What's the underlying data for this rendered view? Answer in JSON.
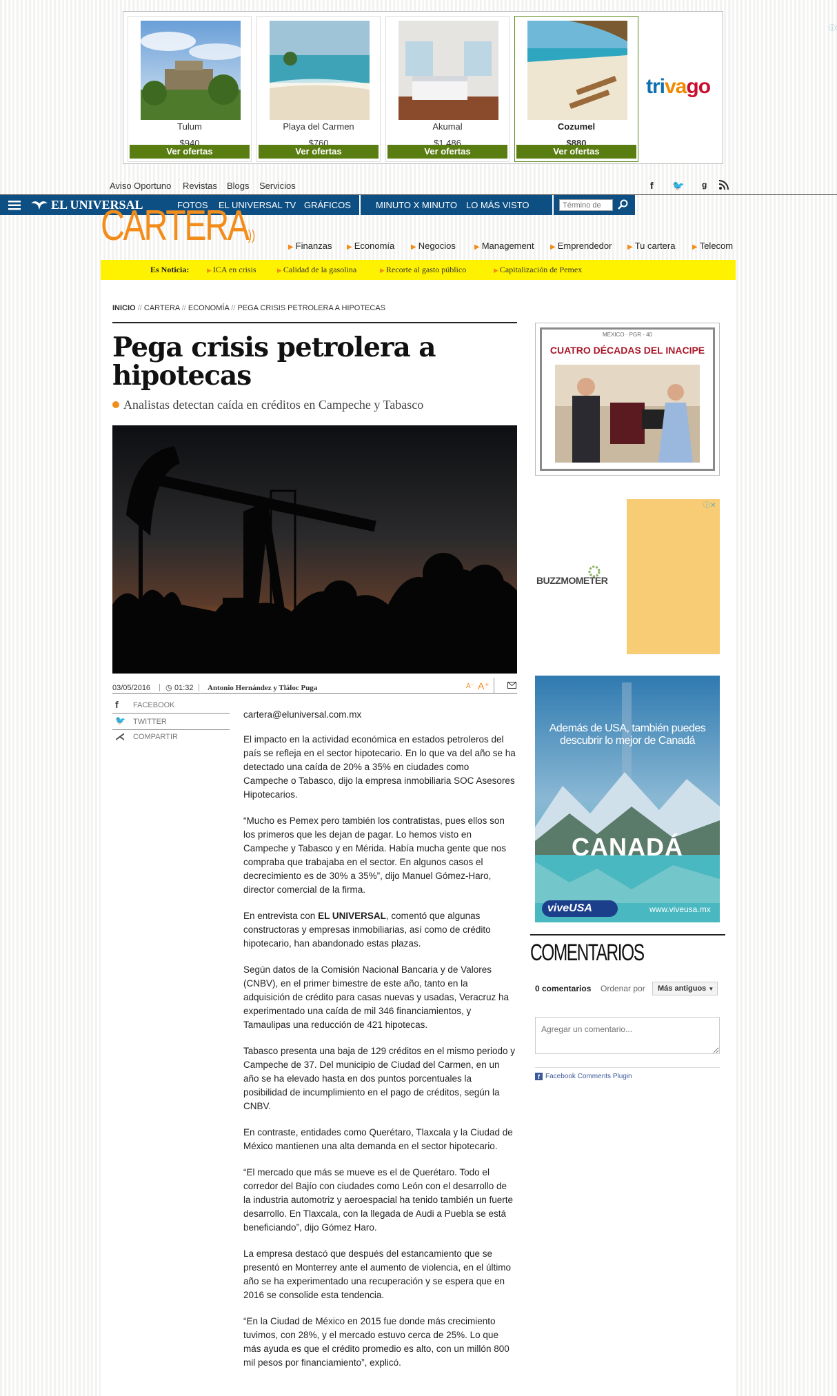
{
  "ad": {
    "hotels": [
      {
        "name": "Tulum",
        "price": "$940",
        "cta": "Ver ofertas"
      },
      {
        "name": "Playa del Carmen",
        "price": "$760",
        "cta": "Ver ofertas"
      },
      {
        "name": "Akumal",
        "price": "$1,486",
        "cta": "Ver ofertas"
      },
      {
        "name": "Cozumel",
        "price": "$880",
        "cta": "Ver ofertas"
      }
    ],
    "brand": "trivago"
  },
  "util": {
    "links": [
      "Aviso Oportuno",
      "Revistas",
      "Blogs",
      "Servicios"
    ],
    "social": [
      "f",
      "t",
      "g",
      "rss"
    ]
  },
  "nav": {
    "logo": "EL UNIVERSAL",
    "items": [
      "FOTOS",
      "EL UNIVERSAL TV",
      "GRÁFICOS",
      "MINUTO X MINUTO",
      "LO MÁS VISTO"
    ],
    "search_placeholder": "Término de"
  },
  "section": {
    "name": "CARTERA",
    "items": [
      "Finanzas",
      "Economía",
      "Negocios",
      "Management",
      "Emprendedor",
      "Tu cartera",
      "Telecom"
    ]
  },
  "es_noticia": {
    "label": "Es Noticia:",
    "items": [
      "ICA en crisis",
      "Calidad de la gasolina",
      "Recorte al gasto público",
      "Capitalización de Pemex"
    ]
  },
  "breadcrumb": [
    "INICIO",
    "CARTERA",
    "ECONOMÍA",
    "PEGA CRISIS PETROLERA A HIPOTECAS"
  ],
  "article": {
    "title": "Pega crisis petrolera a hipotecas",
    "subtitle": "Analistas detectan caída en créditos en Campeche y Tabasco",
    "date": "03/05/2016",
    "time": "01:32",
    "authors": "Antonio Hernández y Tláloc Puga",
    "share": [
      "FACEBOOK",
      "TWITTER",
      "COMPARTIR"
    ],
    "email": "cartera@eluniversal.com.mx",
    "p1": "El impacto en la actividad económica en estados petroleros del país se refleja en el sector hipotecario. En lo que va del año se ha detectado una caída de 20% a 35% en ciudades como Campeche o Tabasco, dijo la empresa inmobiliaria SOC Asesores Hipotecarios.",
    "p2": "“Mucho es Pemex pero también los contratistas, pues ellos son los primeros que les dejan de pagar. Lo hemos visto en Campeche y Tabasco y en Mérida. Había mucha gente que nos compraba que trabajaba en el sector. En algunos casos el decrecimiento es de 30% a 35%”, dijo Manuel Gómez-Haro, director comercial de la firma.",
    "p3_pre": "En entrevista con ",
    "p3_bold": "EL UNIVERSAL",
    "p3_post": ", comentó que algunas constructoras y empresas inmobiliarias, así como de crédito hipotecario, han abandonado estas plazas.",
    "p4": "Según datos de la Comisión Nacional Bancaria y de Valores (CNBV), en el primer bimestre de este año, tanto en la adquisición de crédito para casas nuevas y usadas, Veracruz ha experimentado una caída de mil 346 financiamientos, y Tamaulipas una reducción de 421 hipotecas.",
    "p5": "Tabasco presenta una baja de 129 créditos en el mismo periodo y Campeche de 37. Del municipio de Ciudad del Carmen, en un año se ha elevado hasta en dos puntos porcentuales la posibilidad de incumplimiento en el pago de créditos, según la CNBV.",
    "p6": "En contraste, entidades como Querétaro, Tlaxcala y la Ciudad de México mantienen una alta demanda en el sector hipotecario.",
    "p7": "“El mercado que más se mueve es el de Querétaro. Todo el corredor del Bajío con ciudades como León con el desarrollo de la industria automotriz y aeroespacial ha tenido también un fuerte desarrollo. En Tlaxcala, con la llegada de Audi a Puebla se está beneficiando”, dijo Gómez Haro.",
    "p8": "La empresa destacó que después del estancamiento que se presentó en Monterrey ante el aumento de violencia, en el último año se ha experimentado una recuperación y se espera que en 2016 se consolide esta tendencia.",
    "p9": "“En la Ciudad de México en 2015 fue donde más crecimiento tuvimos, con 28%, y el mercado estuvo cerca de 25%. Lo que más ayuda es que el crédito promedio es alto, con un millón 800 mil pesos por financiamiento”, explicó."
  },
  "sidebar": {
    "inacipe_top": "MÉXICO · PGR · 40",
    "inacipe_title": "CUATRO DÉCADAS DEL INACIPE",
    "buzz": "BUZZMOMETER",
    "canada_text": "Además de USA, también puedes descubrir lo mejor de Canadá",
    "canada_word": "CANADÁ",
    "viveusa": "viveUSA",
    "viveusa_url": "www.viveusa.mx"
  },
  "comments": {
    "title": "COMENTARIOS",
    "count": "0 comentarios",
    "order_label": "Ordenar por",
    "order_value": "Más antiguos",
    "placeholder": "Agregar un comentario...",
    "plugin": "Facebook Comments Plugin"
  },
  "colors": {
    "brand_blue": "#0d4f83",
    "orange": "#f28c1b",
    "yellow": "#fff200",
    "cta_green": "#5a7d12"
  }
}
